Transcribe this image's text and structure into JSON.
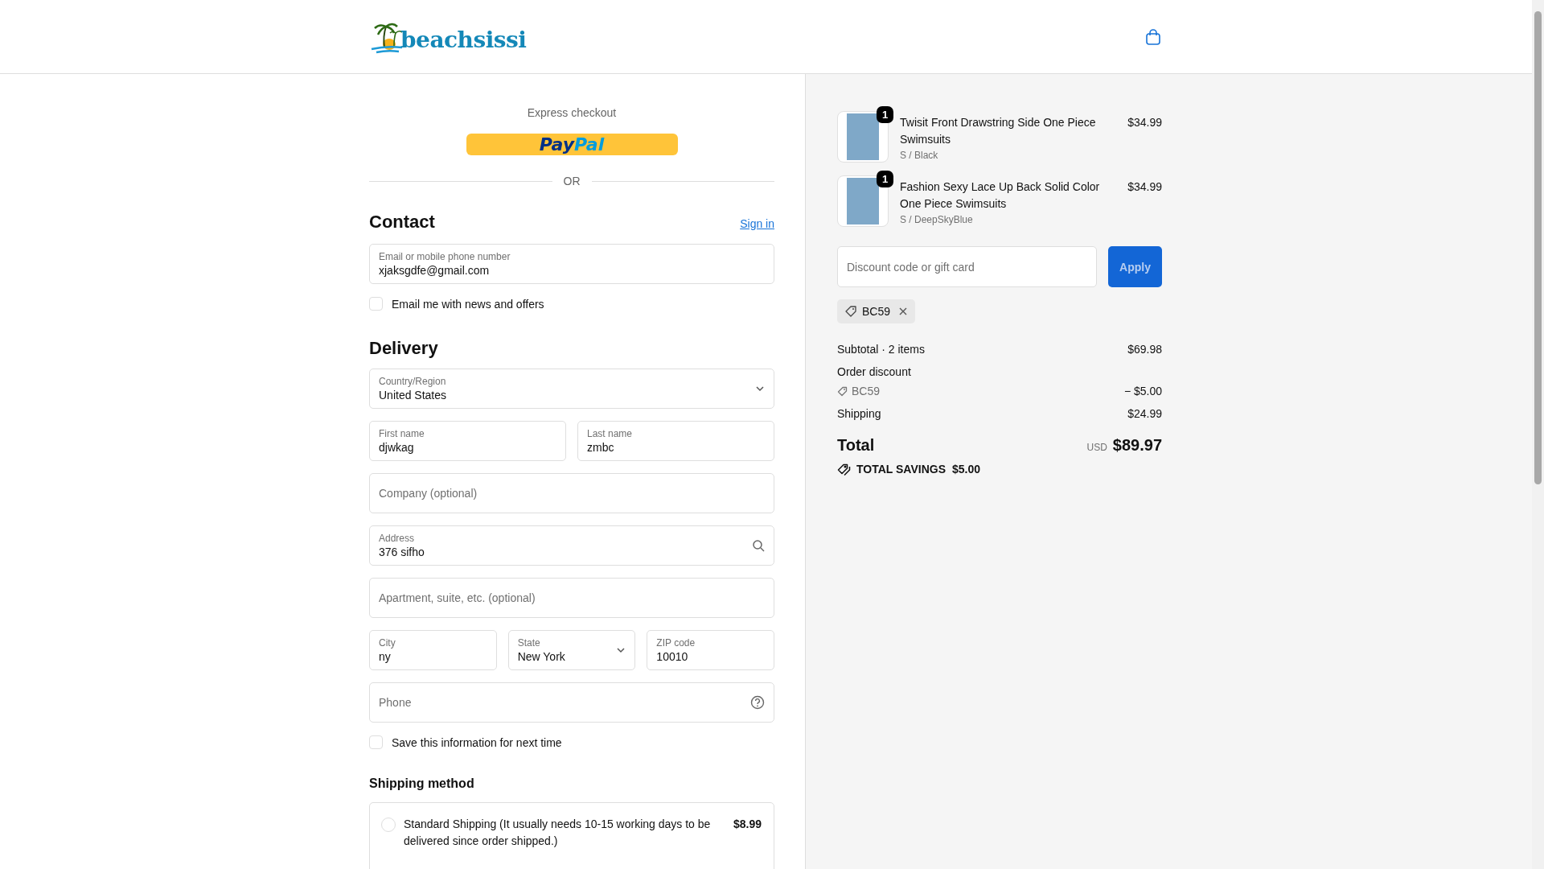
{
  "header": {
    "logo": "beachsissi"
  },
  "express": {
    "label": "Express checkout",
    "paypal": {
      "pay": "Pay",
      "pal": "Pal"
    },
    "divider": "OR"
  },
  "contact": {
    "heading": "Contact",
    "sign_in": "Sign in",
    "email": {
      "label": "Email or mobile phone number",
      "value": "xjaksgdfe@gmail.com"
    },
    "newsletter": {
      "label": "Email me with news and offers",
      "checked": false
    }
  },
  "delivery": {
    "heading": "Delivery",
    "rows": [
      [
        {
          "kind": "select",
          "label": "Country/Region",
          "value": "United States"
        }
      ],
      [
        {
          "kind": "text",
          "label": "First name",
          "value": "djwkag"
        },
        {
          "kind": "text",
          "label": "Last name",
          "value": "zmbc"
        }
      ],
      [
        {
          "kind": "text",
          "placeholder": "Company (optional)"
        }
      ],
      [
        {
          "kind": "search",
          "label": "Address",
          "value": "376 sifho"
        }
      ],
      [
        {
          "kind": "text",
          "placeholder": "Apartment, suite, etc. (optional)"
        }
      ],
      [
        {
          "kind": "text",
          "label": "City",
          "value": "ny"
        },
        {
          "kind": "select",
          "label": "State",
          "value": "New York"
        },
        {
          "kind": "text",
          "label": "ZIP code",
          "value": "10010"
        }
      ],
      [
        {
          "kind": "help",
          "placeholder": "Phone"
        }
      ]
    ],
    "save_info": {
      "label": "Save this information for next time",
      "checked": false
    }
  },
  "shipping_method": {
    "heading": "Shipping method",
    "options": [
      {
        "label": "Standard Shipping (It usually needs 10-15 working days to be delivered since order shipped.)",
        "price": "$8.99",
        "selected": false
      }
    ]
  },
  "summary": {
    "items": [
      {
        "title": "Twisit Front Drawstring Side One Piece Swimsuits",
        "variant": "S / Black",
        "price": "$34.99",
        "quantity": "1"
      },
      {
        "title": "Fashion Sexy Lace Up Back Solid Color One Piece Swimsuits",
        "variant": "S / DeepSkyBlue",
        "price": "$34.99",
        "quantity": "1"
      }
    ],
    "discount": {
      "placeholder": "Discount code or gift card",
      "button": "Apply"
    },
    "applied_code": "BC59",
    "subtotal": {
      "label": "Subtotal · 2 items",
      "value": "$69.98"
    },
    "order_discount": {
      "label": "Order discount",
      "code": "BC59",
      "value": "− $5.00"
    },
    "shipping": {
      "label": "Shipping",
      "value": "$24.99"
    },
    "total": {
      "label": "Total",
      "currency": "USD",
      "value": "$89.97"
    },
    "savings": {
      "label": "TOTAL SAVINGS",
      "value": "$5.00"
    }
  }
}
